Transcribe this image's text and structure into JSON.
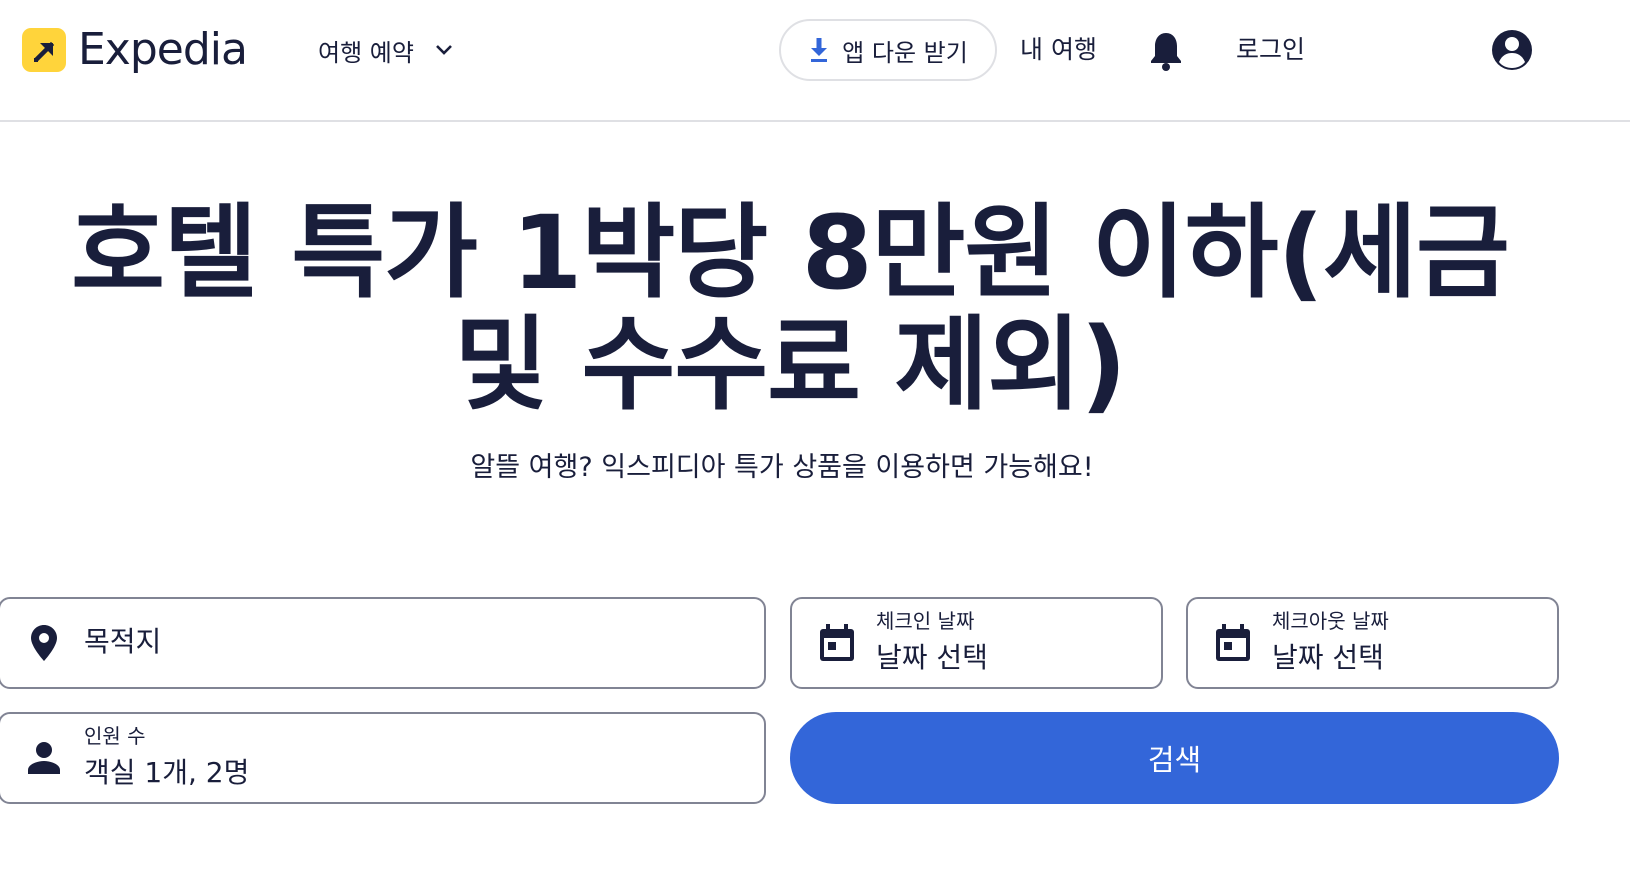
{
  "header": {
    "logo_text": "Expedia",
    "trip_menu_label": "여행 예약",
    "app_download_label": "앱 다운 받기",
    "my_trips_label": "내 여행",
    "login_label": "로그인"
  },
  "hero": {
    "title": "호텔 특가 1박당 8만원 이하(세금 및 수수료 제외)",
    "subtitle": "알뜰 여행? 익스피디아 특가 상품을 이용하면 가능해요!"
  },
  "search": {
    "destination_placeholder": "목적지",
    "checkin_label": "체크인 날짜",
    "checkin_value": "날짜 선택",
    "checkout_label": "체크아웃 날짜",
    "checkout_value": "날짜 선택",
    "travelers_label": "인원 수",
    "travelers_value": "객실 1개, 2명",
    "search_button_label": "검색"
  },
  "colors": {
    "brand_yellow": "#ffd43b",
    "text_dark": "#191e3b",
    "primary_blue": "#3366d9",
    "border_gray": "#818494"
  },
  "icons": [
    "expedia-logo-icon",
    "chevron-down-icon",
    "download-icon",
    "bell-icon",
    "account-icon",
    "map-pin-icon",
    "calendar-icon",
    "person-icon"
  ]
}
